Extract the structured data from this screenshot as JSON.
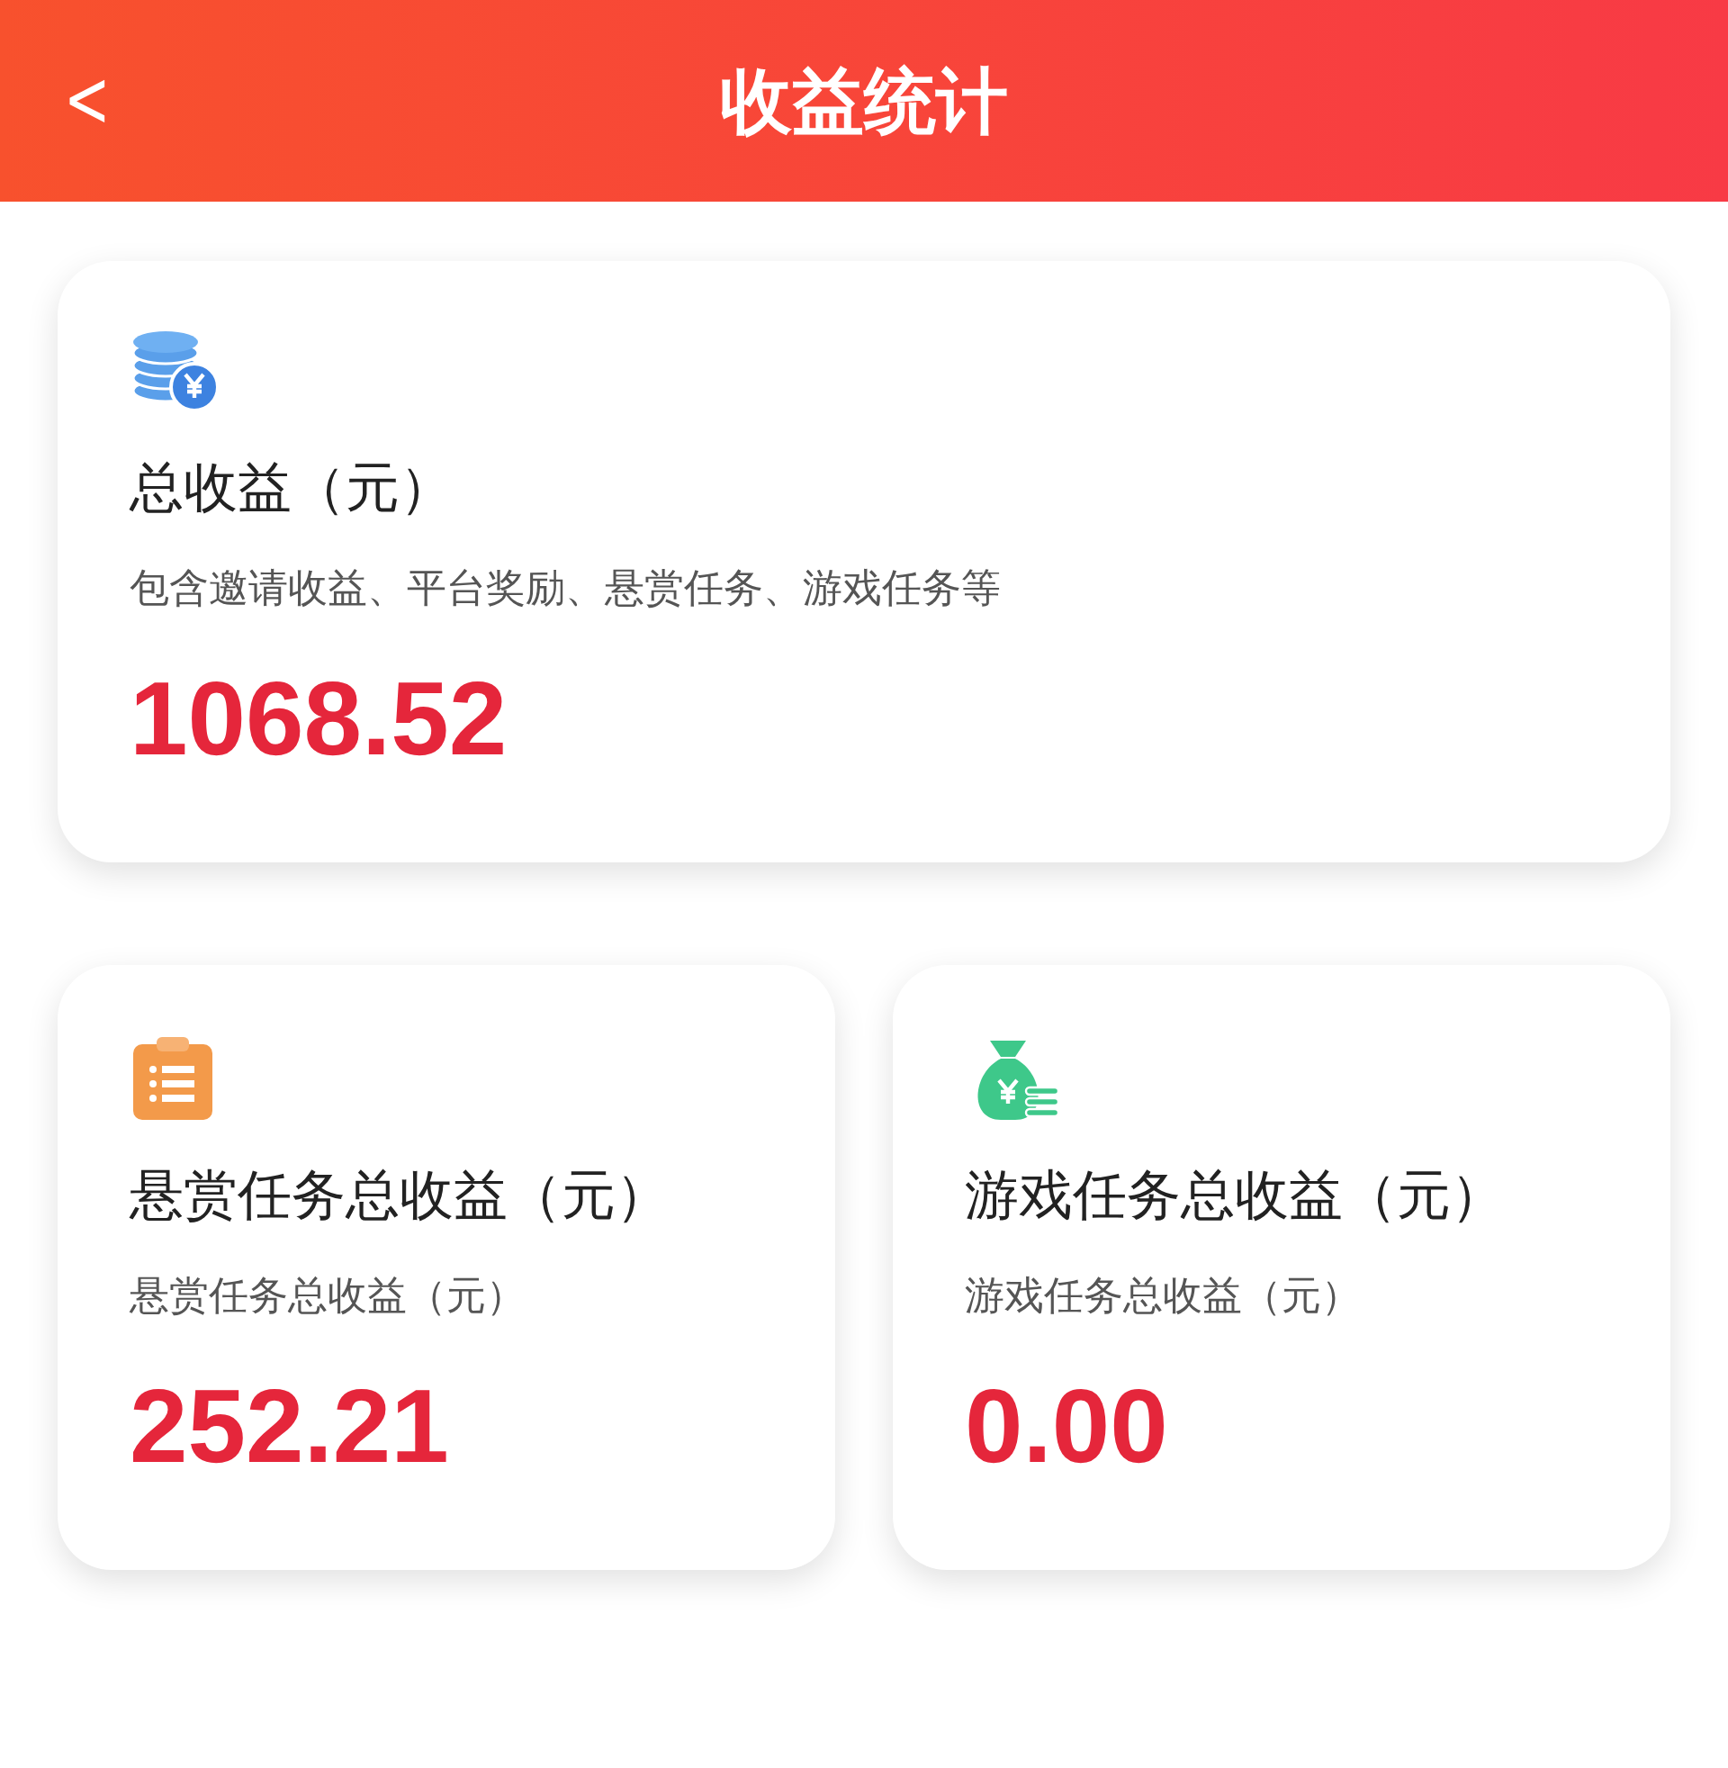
{
  "header": {
    "back": "<",
    "title": "收益统计"
  },
  "cards": [
    {
      "kind": "coins",
      "title": "总收益（元）",
      "subtitle": "包含邀请收益、平台奖励、悬赏任务、游戏任务等",
      "amount": "1068.52"
    },
    {
      "kind": "clipboard",
      "title": "悬赏任务总收益（元）",
      "subtitle": "悬赏任务总收益（元）",
      "amount": "252.21"
    },
    {
      "kind": "moneybag",
      "title": "游戏任务总收益（元）",
      "subtitle": "游戏任务总收益（元）",
      "amount": "0.00"
    }
  ]
}
